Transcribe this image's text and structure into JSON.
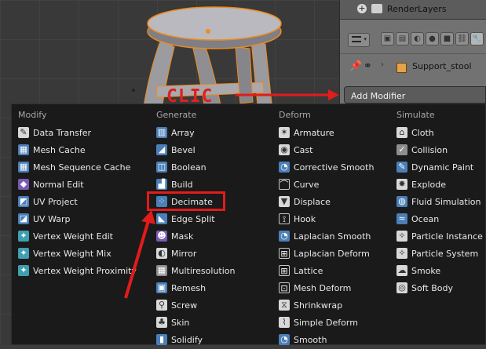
{
  "outliner": {
    "render_layers": "RenderLayers"
  },
  "properties": {
    "object_name": "Support_stool",
    "add_modifier": "Add Modifier"
  },
  "annotation": {
    "label": "CLIC",
    "color": "#e02020"
  },
  "menu": {
    "columns": [
      {
        "header": "Modify",
        "items": [
          {
            "label": "Data Transfer",
            "icon": "data-transfer-icon"
          },
          {
            "label": "Mesh Cache",
            "icon": "mesh-cache-icon"
          },
          {
            "label": "Mesh Sequence Cache",
            "icon": "mesh-sequence-cache-icon"
          },
          {
            "label": "Normal Edit",
            "icon": "normal-edit-icon"
          },
          {
            "label": "UV Project",
            "icon": "uv-project-icon"
          },
          {
            "label": "UV Warp",
            "icon": "uv-warp-icon"
          },
          {
            "label": "Vertex Weight Edit",
            "icon": "vertex-weight-icon"
          },
          {
            "label": "Vertex Weight Mix",
            "icon": "vertex-weight-icon"
          },
          {
            "label": "Vertex Weight Proximity",
            "icon": "vertex-weight-icon"
          }
        ]
      },
      {
        "header": "Generate",
        "items": [
          {
            "label": "Array",
            "icon": "array-icon"
          },
          {
            "label": "Bevel",
            "icon": "bevel-icon"
          },
          {
            "label": "Boolean",
            "icon": "boolean-icon"
          },
          {
            "label": "Build",
            "icon": "build-icon"
          },
          {
            "label": "Decimate",
            "icon": "decimate-icon"
          },
          {
            "label": "Edge Split",
            "icon": "edge-split-icon"
          },
          {
            "label": "Mask",
            "icon": "mask-icon"
          },
          {
            "label": "Mirror",
            "icon": "mirror-icon"
          },
          {
            "label": "Multiresolution",
            "icon": "multires-icon"
          },
          {
            "label": "Remesh",
            "icon": "remesh-icon"
          },
          {
            "label": "Screw",
            "icon": "screw-icon"
          },
          {
            "label": "Skin",
            "icon": "skin-icon"
          },
          {
            "label": "Solidify",
            "icon": "solidify-icon"
          }
        ]
      },
      {
        "header": "Deform",
        "items": [
          {
            "label": "Armature",
            "icon": "armature-icon"
          },
          {
            "label": "Cast",
            "icon": "cast-icon"
          },
          {
            "label": "Corrective Smooth",
            "icon": "smooth-icon"
          },
          {
            "label": "Curve",
            "icon": "curve-icon"
          },
          {
            "label": "Displace",
            "icon": "displace-icon"
          },
          {
            "label": "Hook",
            "icon": "hook-icon"
          },
          {
            "label": "Laplacian Smooth",
            "icon": "smooth-icon"
          },
          {
            "label": "Laplacian Deform",
            "icon": "lattice-icon"
          },
          {
            "label": "Lattice",
            "icon": "lattice-icon"
          },
          {
            "label": "Mesh Deform",
            "icon": "mesh-deform-icon"
          },
          {
            "label": "Shrinkwrap",
            "icon": "shrinkwrap-icon"
          },
          {
            "label": "Simple Deform",
            "icon": "simple-deform-icon"
          },
          {
            "label": "Smooth",
            "icon": "smooth-icon"
          }
        ]
      },
      {
        "header": "Simulate",
        "items": [
          {
            "label": "Cloth",
            "icon": "cloth-icon"
          },
          {
            "label": "Collision",
            "icon": "collision-icon"
          },
          {
            "label": "Dynamic Paint",
            "icon": "brush-icon"
          },
          {
            "label": "Explode",
            "icon": "explode-icon"
          },
          {
            "label": "Fluid Simulation",
            "icon": "fluid-icon"
          },
          {
            "label": "Ocean",
            "icon": "ocean-icon"
          },
          {
            "label": "Particle Instance",
            "icon": "particles-icon"
          },
          {
            "label": "Particle System",
            "icon": "particles-icon"
          },
          {
            "label": "Smoke",
            "icon": "smoke-icon"
          },
          {
            "label": "Soft Body",
            "icon": "soft-body-icon"
          }
        ]
      }
    ]
  }
}
